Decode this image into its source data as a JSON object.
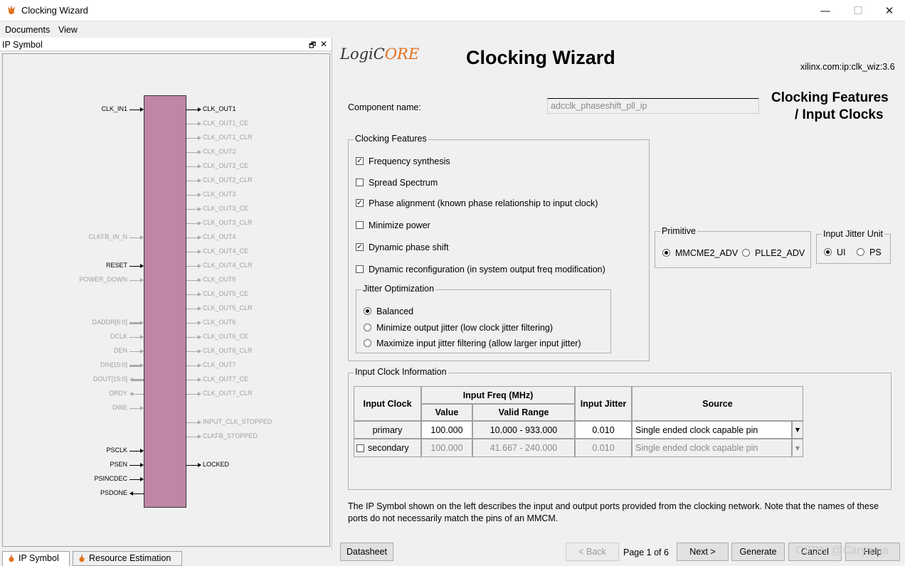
{
  "window": {
    "title": "Clocking Wizard",
    "minimize": "—",
    "maximize": "☐",
    "close": "✕"
  },
  "menu": [
    "Documents",
    "View"
  ],
  "left_panel": {
    "title": "IP Symbol",
    "restore_icon": "🗗",
    "close_icon": "✕",
    "input_ports": [
      {
        "name": "CLK_IN1",
        "active": true,
        "bus": false,
        "dir": "in"
      },
      {
        "name": "CLKFB_IN_N",
        "active": false,
        "bus": false,
        "dir": "in"
      },
      {
        "name": "RESET",
        "active": true,
        "bus": false,
        "dir": "in"
      },
      {
        "name": "POWER_DOWN",
        "active": false,
        "bus": false,
        "dir": "in"
      },
      {
        "name": "DADDR[6:0]",
        "active": false,
        "bus": true,
        "dir": "in"
      },
      {
        "name": "DCLK",
        "active": false,
        "bus": false,
        "dir": "in"
      },
      {
        "name": "DEN",
        "active": false,
        "bus": false,
        "dir": "in"
      },
      {
        "name": "DIN[15:0]",
        "active": false,
        "bus": true,
        "dir": "in"
      },
      {
        "name": "DOUT[15:0]",
        "active": false,
        "bus": true,
        "dir": "out"
      },
      {
        "name": "DRDY",
        "active": false,
        "bus": false,
        "dir": "out"
      },
      {
        "name": "DWE",
        "active": false,
        "bus": false,
        "dir": "in"
      },
      {
        "name": "PSCLK",
        "active": true,
        "bus": false,
        "dir": "in"
      },
      {
        "name": "PSEN",
        "active": true,
        "bus": false,
        "dir": "in"
      },
      {
        "name": "PSINCDEC",
        "active": true,
        "bus": false,
        "dir": "in"
      },
      {
        "name": "PSDONE",
        "active": true,
        "bus": false,
        "dir": "out"
      }
    ],
    "output_ports": [
      {
        "name": "CLK_OUT1",
        "active": true
      },
      {
        "name": "CLK_OUT1_CE",
        "active": false
      },
      {
        "name": "CLK_OUT1_CLR",
        "active": false
      },
      {
        "name": "CLK_OUT2",
        "active": false
      },
      {
        "name": "CLK_OUT2_CE",
        "active": false
      },
      {
        "name": "CLK_OUT2_CLR",
        "active": false
      },
      {
        "name": "CLK_OUT3",
        "active": false
      },
      {
        "name": "CLK_OUT3_CE",
        "active": false
      },
      {
        "name": "CLK_OUT3_CLR",
        "active": false
      },
      {
        "name": "CLK_OUT4",
        "active": false
      },
      {
        "name": "CLK_OUT4_CE",
        "active": false
      },
      {
        "name": "CLK_OUT4_CLR",
        "active": false
      },
      {
        "name": "CLK_OUT5",
        "active": false
      },
      {
        "name": "CLK_OUT5_CE",
        "active": false
      },
      {
        "name": "CLK_OUT5_CLR",
        "active": false
      },
      {
        "name": "CLK_OUT6",
        "active": false
      },
      {
        "name": "CLK_OUT6_CE",
        "active": false
      },
      {
        "name": "CLK_OUT6_CLR",
        "active": false
      },
      {
        "name": "CLK_OUT7",
        "active": false
      },
      {
        "name": "CLK_OUT7_CE",
        "active": false
      },
      {
        "name": "CLK_OUT7_CLR",
        "active": false
      },
      {
        "name": "INPUT_CLK_STOPPED",
        "active": false
      },
      {
        "name": "CLKFB_STOPPED",
        "active": false
      },
      {
        "name": "LOCKED",
        "active": true
      }
    ],
    "tabs": [
      {
        "label": "IP Symbol",
        "active": true
      },
      {
        "label": "Resource Estimation",
        "active": false
      }
    ]
  },
  "header": {
    "logo_text_a": "LogiC",
    "logo_text_b": "ORE",
    "title": "Clocking Wizard",
    "vlnv": "xilinx.com:ip:clk_wiz:3.6",
    "page_heading_line1": "Clocking Features",
    "page_heading_line2": "/ Input Clocks"
  },
  "component": {
    "label": "Component name:",
    "value": "adcclk_phaseshift_pll_ip"
  },
  "clocking_features": {
    "title": "Clocking Features",
    "options": [
      {
        "label": "Frequency synthesis",
        "checked": true
      },
      {
        "label": "Spread Spectrum",
        "checked": false
      },
      {
        "label": "Phase alignment (known phase relationship to input clock)",
        "checked": true
      },
      {
        "label": "Minimize power",
        "checked": false
      },
      {
        "label": "Dynamic phase shift",
        "checked": true
      },
      {
        "label": "Dynamic reconfiguration (in system output freq modification)",
        "checked": false
      }
    ],
    "jitter": {
      "title": "Jitter Optimization",
      "options": [
        {
          "label": "Balanced",
          "selected": true
        },
        {
          "label": "Minimize output jitter (low clock jitter filtering)",
          "selected": false
        },
        {
          "label": "Maximize input jitter filtering (allow larger input jitter)",
          "selected": false
        }
      ]
    }
  },
  "primitive": {
    "title": "Primitive",
    "options": [
      {
        "label": "MMCME2_ADV",
        "selected": true
      },
      {
        "label": "PLLE2_ADV",
        "selected": false
      }
    ]
  },
  "jitter_unit": {
    "title": "Input Jitter Unit",
    "options": [
      {
        "label": "UI",
        "selected": true
      },
      {
        "label": "PS",
        "selected": false
      }
    ]
  },
  "input_clock_info": {
    "title": "Input Clock Information",
    "headers": {
      "input_clock": "Input Clock",
      "input_freq": "Input Freq (MHz)",
      "value": "Value",
      "valid_range": "Valid Range",
      "input_jitter": "Input Jitter",
      "source": "Source"
    },
    "rows": [
      {
        "name": "primary",
        "value": "100.000",
        "range": "10.000 - 933.000",
        "jitter": "0.010",
        "source": "Single ended clock capable pin",
        "enabled": true
      },
      {
        "name": "secondary",
        "value": "100.000",
        "range": "41.667 - 240.000",
        "jitter": "0.010",
        "source": "Single ended clock capable pin",
        "enabled": false
      }
    ]
  },
  "description": "The IP Symbol shown on the left describes the input and output ports provided from the clocking network.  Note that the names of these ports do not necessarily match the pins of an MMCM.",
  "footer": {
    "datasheet": "Datasheet",
    "back": "< Back",
    "page_indicator": "Page 1 of 6",
    "next": "Next >",
    "generate": "Generate",
    "cancel": "Cancel",
    "help": "Help",
    "watermark": "CSDN @Carymna"
  },
  "colors": {
    "ip_block": "#bf86a5",
    "logo_core": "#e2711d"
  }
}
